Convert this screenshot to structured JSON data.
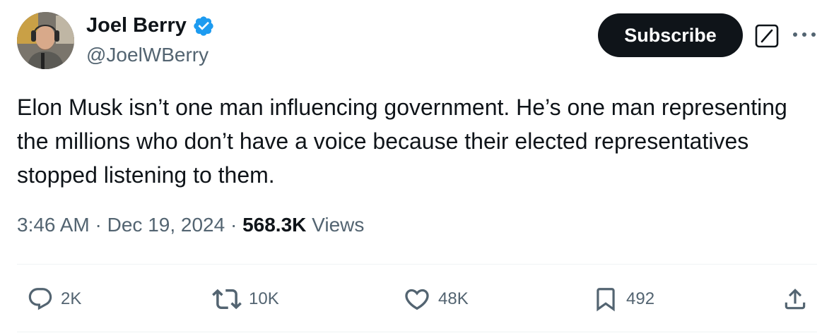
{
  "author": {
    "name": "Joel Berry",
    "handle": "@JoelWBerry",
    "verified": true,
    "verified_color": "#1d9bf0"
  },
  "header": {
    "subscribe_label": "Subscribe",
    "grok_icon": "grok-icon",
    "more_icon": "more-icon"
  },
  "tweet": {
    "text": "Elon Musk isn’t one man influencing government. He’s one man representing the millions who don’t have a voice because their elected representatives stopped listening to them.",
    "time": "3:46 AM",
    "separator": "·",
    "date": "Dec 19, 2024",
    "views_count": "568.3K",
    "views_label": "Views"
  },
  "actions": {
    "replies": "2K",
    "reposts": "10K",
    "likes": "48K",
    "bookmarks": "492"
  },
  "colors": {
    "text_primary": "#0f1419",
    "text_secondary": "#536471",
    "divider": "#eff3f4",
    "button_bg": "#0f1419"
  }
}
